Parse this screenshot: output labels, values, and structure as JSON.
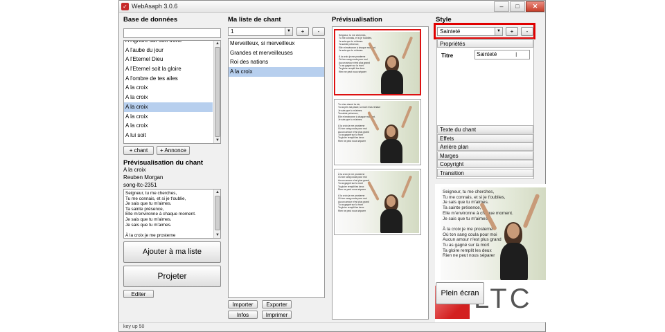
{
  "window": {
    "title": "WebAsaph 3.0.6",
    "minimize": "–",
    "maximize": "□",
    "close": "✕"
  },
  "database": {
    "header": "Base de données",
    "search_value": "",
    "songs": [
      "A l'ignoré sur son trône",
      "A l'aube du jour",
      "A l'Eternel Dieu",
      "A l'Eternel soit la gloire",
      "A l'ombre de tes ailes",
      "A la croix",
      "A la croix",
      "A la croix",
      "A la croix",
      "A la croix",
      "A lui soit"
    ],
    "selected_index": 7,
    "add_song_btn": "+ chant",
    "add_announce_btn": "+ Annonce"
  },
  "song_preview": {
    "header": "Prévisualisation du chant",
    "title": "A la croix",
    "author": "Reuben Morgan",
    "code": "song-ltc-2351",
    "lyrics": "Seigneur, tu me cherches,\nTu me connais, et si je t'oublie,\nJe sais que tu m'aimes.\nTa sainte présence,\nElle m'environne à chaque moment.\nJe sais que tu m'aimes.\nJe sais que tu m'aimes.\n\nÀ la croix je me prosterne\nOù ton sang coula pour moi",
    "add_to_list_btn": "Ajouter à ma liste",
    "project_btn": "Projeter",
    "edit_btn": "Editer"
  },
  "my_list": {
    "header": "Ma liste de chant",
    "combo_value": "1",
    "plus_btn": "+",
    "minus_btn": "-",
    "items": [
      "Merveilleux, si merveilleux",
      "Grandes et merveilleuses",
      "Roi des nations",
      "A la croix"
    ],
    "selected_index": 3,
    "import_btn": "Importer",
    "export_btn": "Exporter",
    "infos_btn": "Infos",
    "print_btn": "Imprimer"
  },
  "preview": {
    "header": "Prévisualisation",
    "slides": [
      "Seigneur, tu me cherches,\nTu me connais, et si je t'oublies,\nJe sais que tu m'aimes.\nTa sainte présence,\nElle m'environne à chaque moment.\nJe sais que tu m'aimes.\n\nÀ la croix je me prosterne\nOù ton sang coula pour moi\nAucun amour n'est plus grand\nTu as gagné sur la mort\nTa gloire remplit les deux\nRien ne peut nous séparer",
      "Tu m'as donné ta vie,\nTu as pris ma place, la mort m'as rendue\nJe sais que tu m'aimes.\nTa sainte présence,\nElle m'environne à chaque moment.\nJe sais que tu m'aimes.\n\nÀ la croix je me prosterne\nOù ton sang coula pour moi\nAucun amour n'est plus grand\nTu as gagné sur la mort\nTa gloire remplit les deux\nRien ne peut nous séparer",
      "À la croix je me prosterne\nOù ton sang coula pour moi\nAucun amour n'est plus grand\nTu as gagné sur la mort\nTa gloire remplit les deux\nRien ne peut nous séparer\n\nÀ la croix je me prosterne\nOù ton sang coula pour moi\nAucun amour n'est plus grand\nTu as gagné sur la mort\nTa gloire remplit les deux\nRien ne peut nous séparer"
    ]
  },
  "style": {
    "header": "Style",
    "combo_value": "Sainteté",
    "plus_btn": "+",
    "minus_btn": "-",
    "properties_tab": "Propriétés",
    "title_label": "Titre",
    "title_value": "Sainteté",
    "sections": [
      "Texte du chant",
      "Effets",
      "Arrière plan",
      "Marges",
      "Copyright",
      "Transition"
    ]
  },
  "live": {
    "text": "Seigneur, tu me cherches,\nTu me connais, et si je t'oublies,\nJe sais que tu m'aimes.\nTa sainte présence,\nElle m'environne à chaque moment.\nJe sais que tu m'aimes.\n\nÀ la croix je me prosterne\nOù ton sang coula pour moi\nAucun amour n'est plus grand\nTu as gagné sur la mort\nTa gloire remplit les deux\nRien ne peut nous séparer",
    "fullscreen_btn": "Plein écran",
    "logo_text": "LTC"
  },
  "status_bar": {
    "text": "key up 50"
  },
  "colors": {
    "selection": "#b7cfee",
    "highlight": "#e00000",
    "logo_red": "#d32020"
  }
}
